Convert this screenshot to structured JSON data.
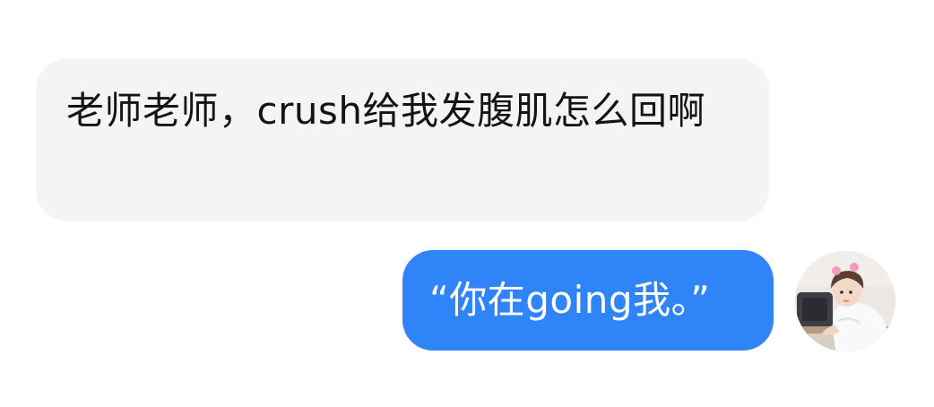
{
  "messages": [
    {
      "direction": "incoming",
      "text": "老师老师，crush给我发腹肌怎么回啊"
    },
    {
      "direction": "outgoing",
      "text": "“你在going我。”"
    }
  ],
  "avatar": {
    "icon": "child-avatar-photo"
  },
  "colors": {
    "incoming_bubble": "#f4f4f4",
    "outgoing_bubble": "#2f84f7",
    "outgoing_text": "#ffffff",
    "incoming_text": "#141414"
  }
}
